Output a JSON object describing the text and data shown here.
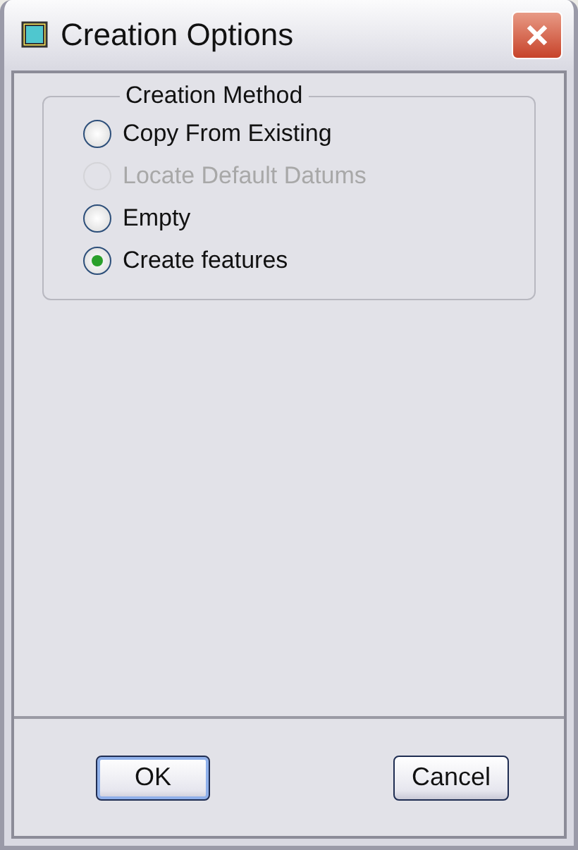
{
  "window": {
    "title": "Creation Options"
  },
  "group": {
    "title": "Creation Method",
    "options": [
      {
        "label": "Copy From Existing",
        "selected": false,
        "disabled": false
      },
      {
        "label": "Locate Default Datums",
        "selected": false,
        "disabled": true
      },
      {
        "label": "Empty",
        "selected": false,
        "disabled": false
      },
      {
        "label": "Create features",
        "selected": true,
        "disabled": false
      }
    ]
  },
  "buttons": [
    {
      "label": "OK",
      "default": true
    },
    {
      "label": "Cancel",
      "default": false
    }
  ]
}
